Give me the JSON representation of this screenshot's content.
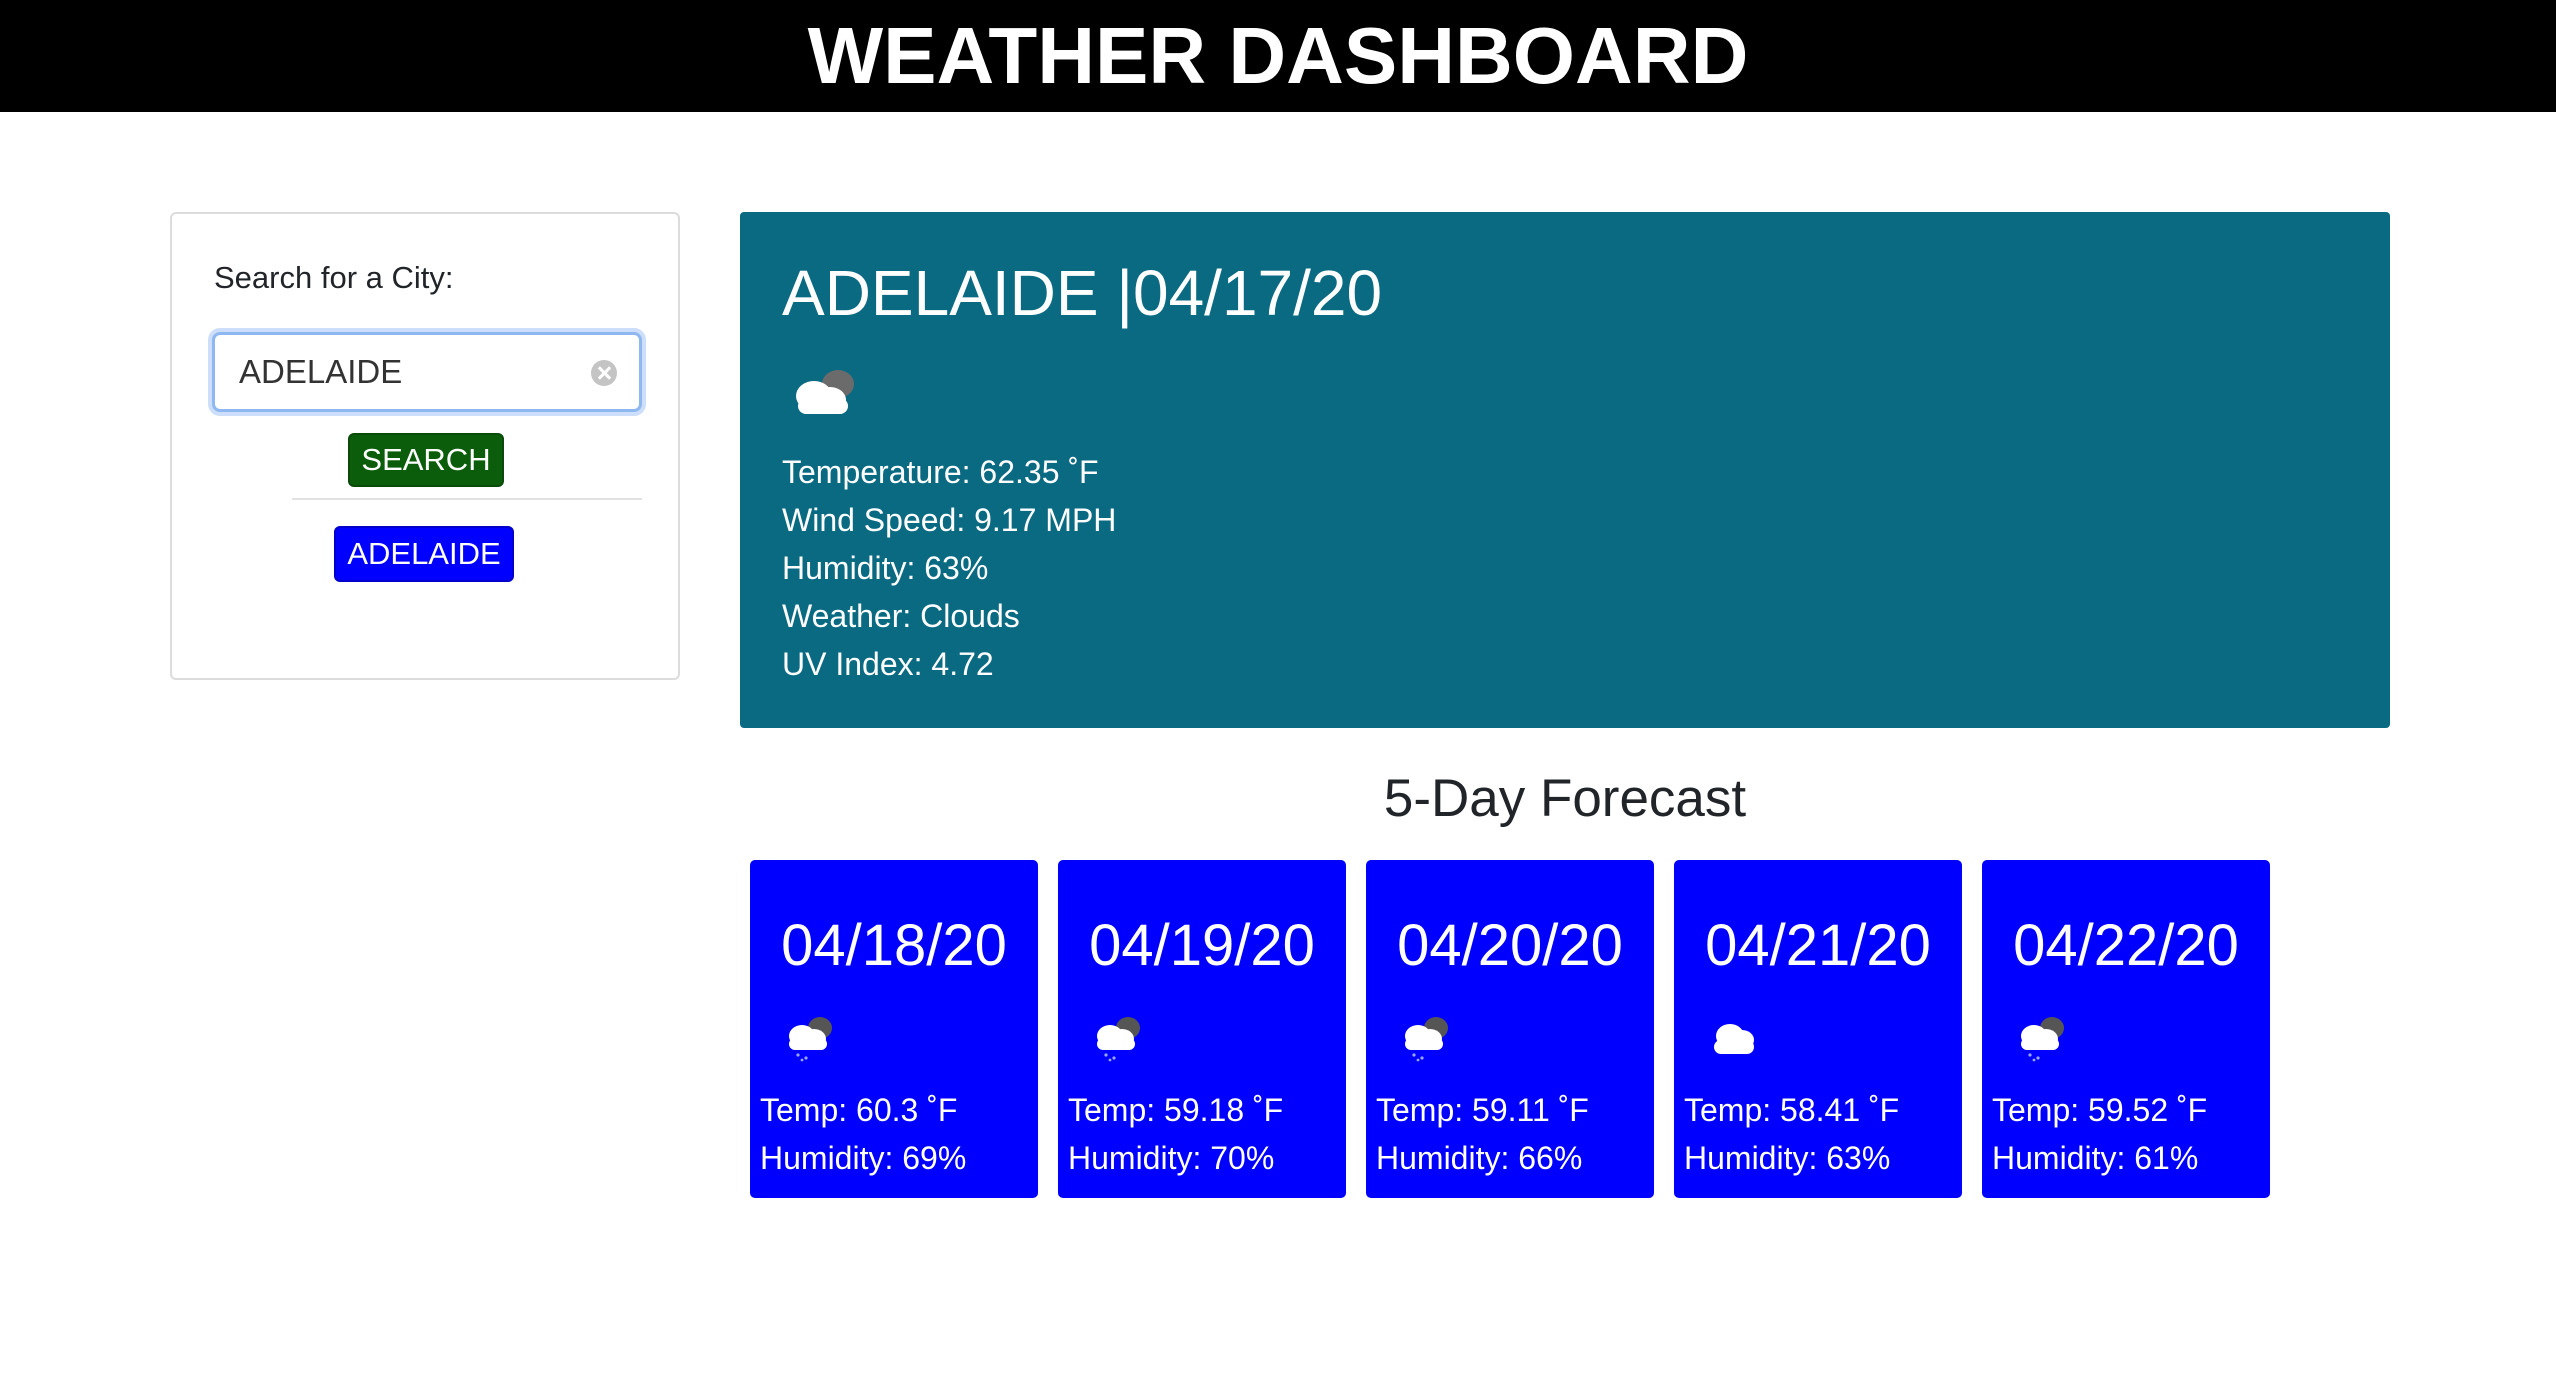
{
  "header": {
    "title": "WEATHER DASHBOARD"
  },
  "search": {
    "label": "Search for a City:",
    "input_value": "ADELAIDE",
    "button_label": "SEARCH",
    "history": [
      "ADELAIDE"
    ]
  },
  "current": {
    "title": "ADELAIDE |04/17/20",
    "icon": "broken-clouds-icon",
    "temperature": "Temperature: 62.35 ˚F",
    "wind": "Wind Speed: 9.17 MPH",
    "humidity": "Humidity: 63%",
    "weather": "Weather: Clouds",
    "uv": "UV Index: 4.72"
  },
  "forecast": {
    "title": "5-Day Forecast",
    "days": [
      {
        "date": "04/18/20",
        "icon": "rain-clouds-icon",
        "temp": "Temp: 60.3 ˚F",
        "humidity": "Humidity: 69%"
      },
      {
        "date": "04/19/20",
        "icon": "rain-clouds-icon",
        "temp": "Temp: 59.18 ˚F",
        "humidity": "Humidity: 70%"
      },
      {
        "date": "04/20/20",
        "icon": "rain-clouds-icon",
        "temp": "Temp: 59.11 ˚F",
        "humidity": "Humidity: 66%"
      },
      {
        "date": "04/21/20",
        "icon": "cloud-icon",
        "temp": "Temp: 58.41 ˚F",
        "humidity": "Humidity: 63%"
      },
      {
        "date": "04/22/20",
        "icon": "rain-clouds-icon",
        "temp": "Temp: 59.52 ˚F",
        "humidity": "Humidity: 61%"
      }
    ]
  },
  "colors": {
    "header_bg": "#000000",
    "current_bg": "#0a6a82",
    "forecast_bg": "#0000ff",
    "search_btn": "#0b5d0b",
    "history_btn": "#0000ff"
  }
}
